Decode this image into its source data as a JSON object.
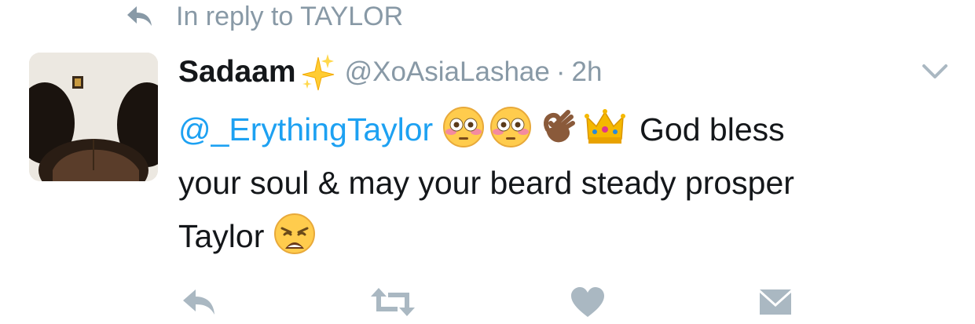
{
  "reply_context": {
    "text": "In reply to TAYLOR",
    "icon": "reply-arrow-icon"
  },
  "tweet": {
    "author_name": "Sadaam",
    "author_emoji": "sparkles-icon",
    "handle": "@XoAsiaLashae",
    "separator": "·",
    "timestamp": "2h",
    "mention": "@_ErythingTaylor",
    "text_part_1": "God bless",
    "text_part_2": "your soul & may your beard steady prosper",
    "text_part_3": "Taylor",
    "emojis": [
      "flushed-face-icon",
      "flushed-face-icon",
      "ok-hand-icon",
      "crown-icon",
      "weary-face-icon"
    ]
  },
  "actions": [
    "reply-icon",
    "retweet-icon",
    "like-icon",
    "direct-message-icon"
  ],
  "colors": {
    "link": "#1da1f2",
    "muted": "#8899a6",
    "text": "#14171a",
    "icon": "#aab8c2"
  }
}
